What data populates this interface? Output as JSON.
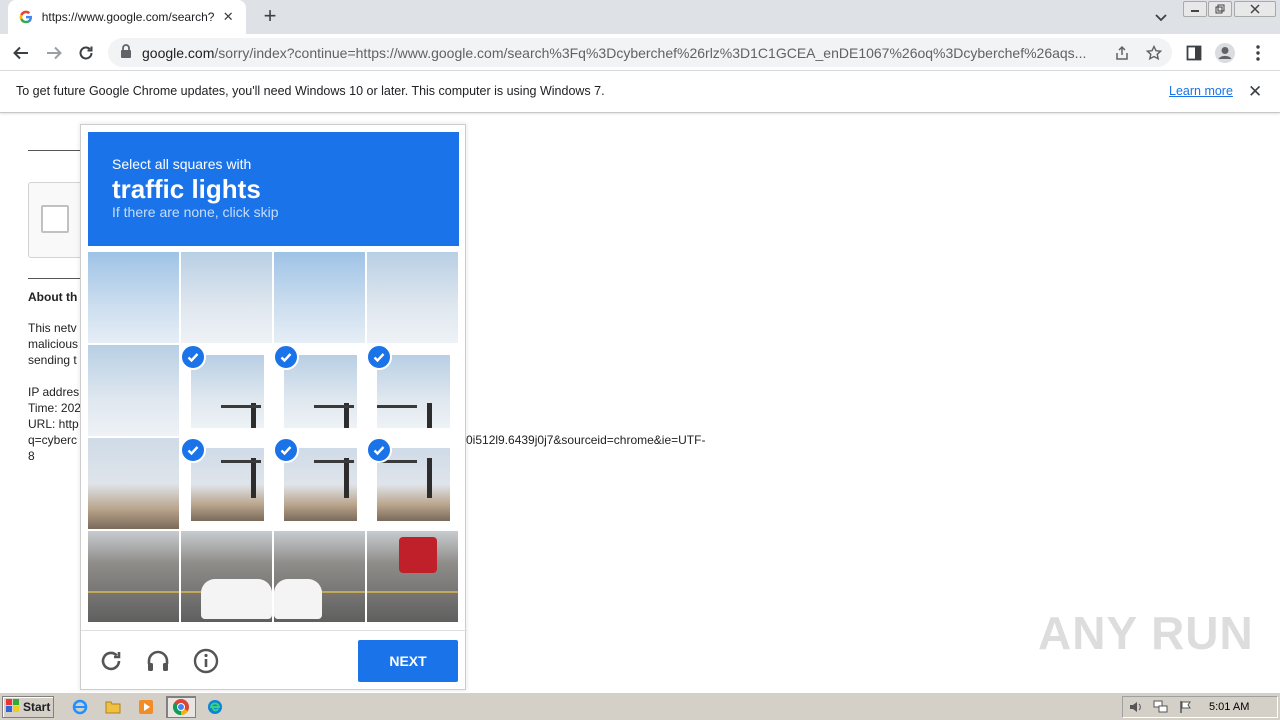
{
  "browser": {
    "tab_title": "https://www.google.com/search?q=",
    "url_host": "google.com",
    "url_rest": "/sorry/index?continue=https://www.google.com/search%3Fq%3Dcyberchef%26rlz%3D1C1GCEA_enDE1067%26oq%3Dcyberchef%26aqs...",
    "new_tab": "+",
    "close_tab": "✕"
  },
  "infobar": {
    "message": "To get future Google Chrome updates, you'll need Windows 10 or later. This computer is using Windows 7.",
    "learn_more": "Learn more",
    "close": "✕"
  },
  "page": {
    "about_heading": "About th",
    "line1": "This netv",
    "line2": "malicious",
    "line3": "sending t",
    "ip": "IP addres",
    "time": "Time: 202",
    "url_label": "URL: http",
    "q_line": "q=cyberc",
    "url_tail": "0i512l9.6439j0j7&sourceid=chrome&ie=UTF-",
    "eight": "8"
  },
  "captcha": {
    "instruction": "Select all squares with",
    "target": "traffic lights",
    "hint": "If there are none, click skip",
    "next_label": "NEXT",
    "selected_tiles": [
      5,
      6,
      7,
      9,
      10,
      11
    ]
  },
  "watermark": "ANY RUN",
  "taskbar": {
    "start_label": "Start",
    "clock": "5:01 AM"
  },
  "colors": {
    "captcha_blue": "#1a73e8",
    "chrome_tabstrip": "#dee1e6",
    "taskbar": "#d4d0c8"
  }
}
